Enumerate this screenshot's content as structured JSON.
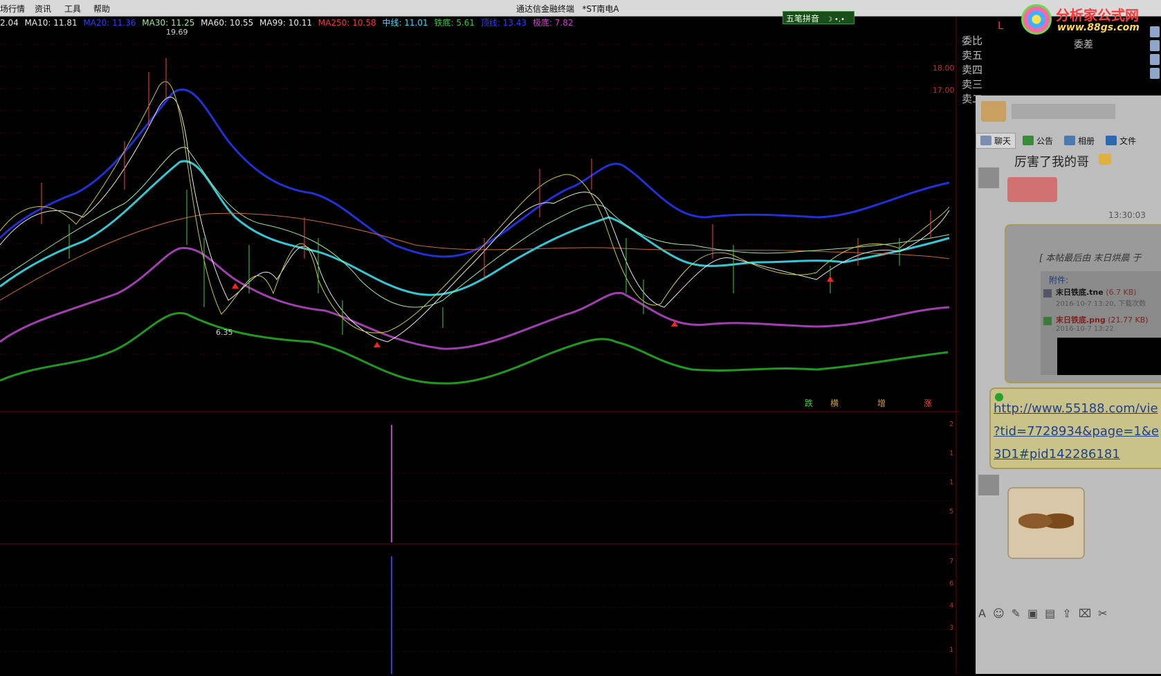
{
  "menubar": {
    "items": [
      "场行情",
      "资讯",
      "工具",
      "帮助"
    ],
    "title_app": "通达信金融终端",
    "title_stock": "*ST南电A"
  },
  "ime": {
    "label": "五笔拼音",
    "icons": "☽ •,•"
  },
  "ma_legend": [
    {
      "text": "2.04",
      "color": "#e8e8e8"
    },
    {
      "text": "MA10: 11.81",
      "color": "#e8e8e8"
    },
    {
      "text": "MA20: 11.36",
      "color": "#2d3cff"
    },
    {
      "text": "MA30: 11.25",
      "color": "#9fe89f"
    },
    {
      "text": "MA60: 10.55",
      "color": "#e8e8e8"
    },
    {
      "text": "MA99: 10.11",
      "color": "#e8e8e8"
    },
    {
      "text": "MA250: 10.58",
      "color": "#ff3333"
    },
    {
      "text": "中线: 11.01",
      "color": "#33e0ff"
    },
    {
      "text": "铁底: 5.61",
      "color": "#33cc33"
    },
    {
      "text": "顶线: 13.43",
      "color": "#2d3cff"
    },
    {
      "text": "极底: 7.82",
      "color": "#cc44cc"
    }
  ],
  "chart": {
    "high_label": "19.69",
    "low_label": "6.35",
    "price_ticks": [
      "18.00",
      "17.00"
    ],
    "signals": [
      "跌",
      "横",
      "增",
      "涨"
    ],
    "lower_ticks_1": [
      "2",
      "1",
      "1",
      "5"
    ],
    "lower_ticks_2": [
      "7",
      "6",
      "4",
      "3",
      "1"
    ]
  },
  "logo": {
    "name": "分析家公式网",
    "url": "www.88gs.com"
  },
  "order_book": {
    "col_header": "L",
    "rows": [
      "委比",
      "卖五",
      "卖四",
      "卖三",
      "卖二"
    ],
    "diff_label": "委差"
  },
  "chat": {
    "tabs": [
      {
        "label": "聊天",
        "icon_color": "#7a8fb0"
      },
      {
        "label": "公告",
        "icon_color": "#3a8a3a"
      },
      {
        "label": "相册",
        "icon_color": "#4a7ab0"
      },
      {
        "label": "文件",
        "icon_color": "#2a6ab0"
      }
    ],
    "message_snippet": "厉害了我的哥",
    "timestamp": "13:30:03",
    "post_header": "[ 本帖最后由 末日烘晨 于",
    "attachment_title": "附件:",
    "file1_name": "末日铁底.tne",
    "file1_size": "(6.7 KB)",
    "file1_meta": "2016-10-7 13:20, 下载次数",
    "file2_name": "末日铁底.png",
    "file2_size": "(21.77 KB)",
    "file2_meta": "2016-10-7 13:22",
    "link_lines": [
      "http://www.55188.com/vie",
      "?tid=7728934&page=1&e",
      "3D1#pid142286181"
    ]
  }
}
